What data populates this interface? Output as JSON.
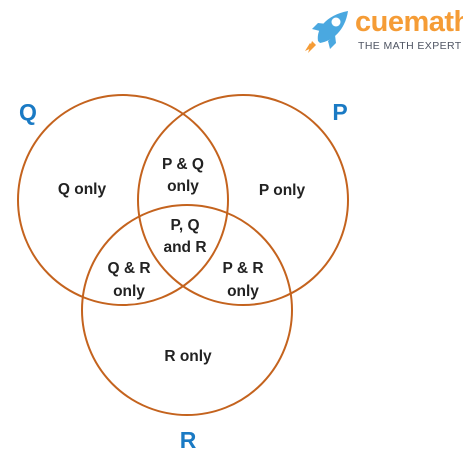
{
  "brand": {
    "name": "cuemath",
    "tagline": "THE MATH EXPERT",
    "name_color": "#f59c36",
    "tagline_color": "#4f5563"
  },
  "colors": {
    "circle_stroke": "#c4631e",
    "set_label": "#1a7ac4",
    "region_text": "#222222",
    "rocket_body": "#4aa8e0",
    "rocket_flame": "#f59c36"
  },
  "diagram": {
    "set_labels": {
      "q": "Q",
      "p": "P",
      "r": "R"
    },
    "regions": {
      "q_only": "Q only",
      "p_only": "P only",
      "r_only": "R only",
      "pq": [
        "P & Q",
        "only"
      ],
      "qr": [
        "Q & R",
        "only"
      ],
      "pr": [
        "P & R",
        "only"
      ],
      "pqr": [
        "P, Q",
        "and R"
      ]
    }
  }
}
